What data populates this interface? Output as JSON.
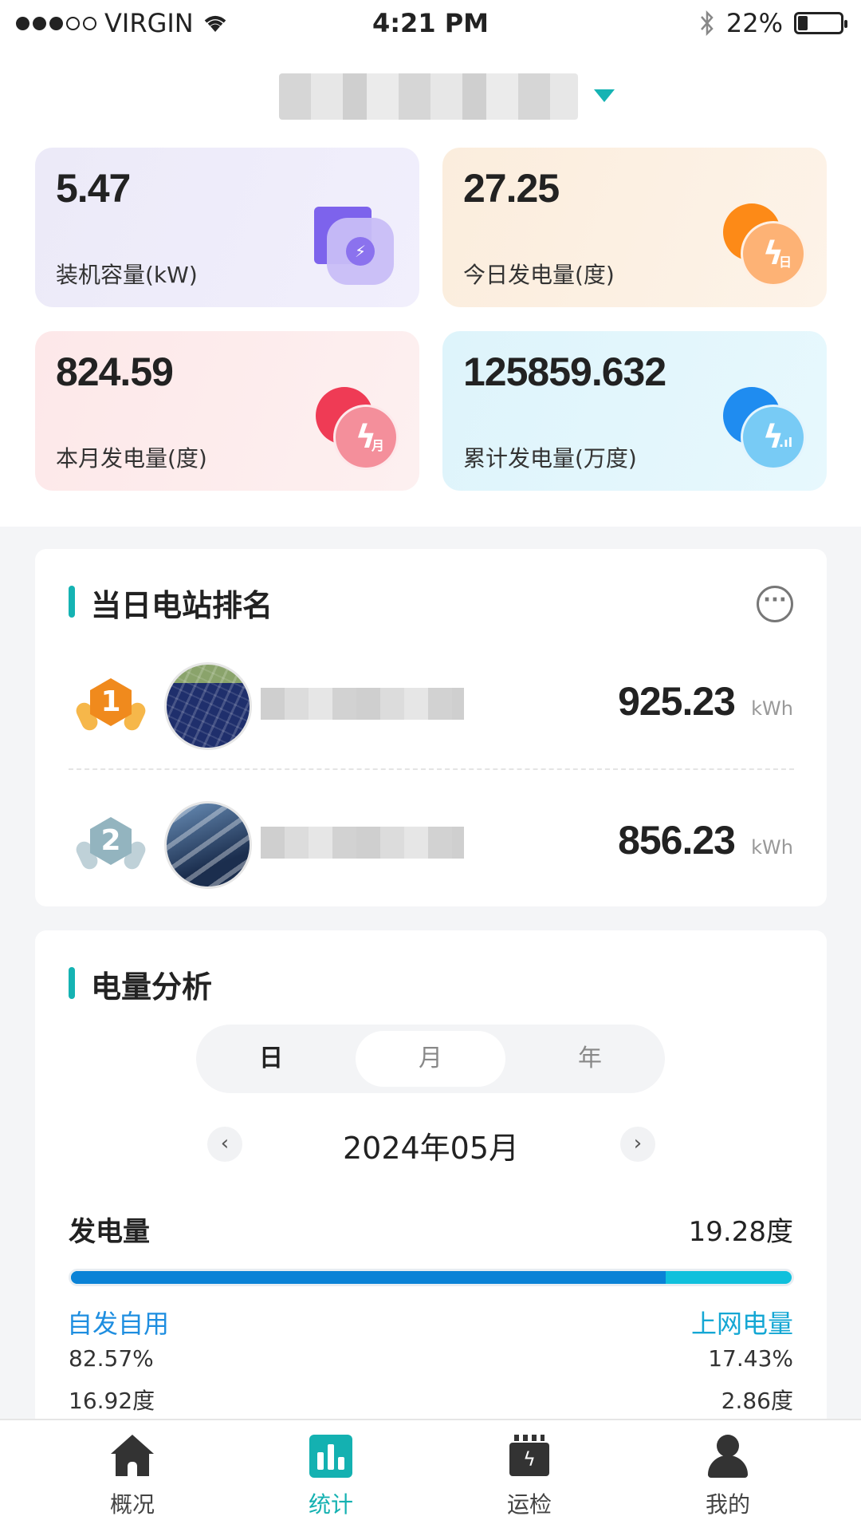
{
  "status_bar": {
    "carrier": "VIRGIN",
    "time": "4:21 PM",
    "battery": "22%"
  },
  "stats": {
    "capacity": {
      "value": "5.47",
      "label": "装机容量(kW)"
    },
    "today": {
      "value": "27.25",
      "label": "今日发电量(度)"
    },
    "month": {
      "value": "824.59",
      "label": "本月发电量(度)"
    },
    "total": {
      "value": "125859.632",
      "label": "累计发电量(万度)"
    }
  },
  "ranking": {
    "title": "当日电站排名",
    "rows": [
      {
        "rank": "1",
        "value": "925.23",
        "unit": "kWh"
      },
      {
        "rank": "2",
        "value": "856.23",
        "unit": "kWh"
      }
    ]
  },
  "analysis": {
    "title": "电量分析",
    "segments": [
      "日",
      "月",
      "年"
    ],
    "selected_segment": "月",
    "period": "2024年05月",
    "generation_label": "发电量",
    "generation_value": "19.28度",
    "self_use": {
      "label": "自发自用",
      "percent": "82.57%",
      "amount": "16.92度",
      "fraction": 0.8257
    },
    "grid": {
      "label": "上网电量",
      "percent": "17.43%",
      "amount": "2.86度",
      "fraction": 0.1743
    },
    "colors": {
      "self_use": "#0a82d6",
      "grid": "#10c0dc"
    }
  },
  "tabs": [
    {
      "label": "概况",
      "icon": "home-icon"
    },
    {
      "label": "统计",
      "icon": "bar-chart-icon",
      "active": true
    },
    {
      "label": "运检",
      "icon": "maintenance-icon"
    },
    {
      "label": "我的",
      "icon": "user-icon"
    }
  ]
}
